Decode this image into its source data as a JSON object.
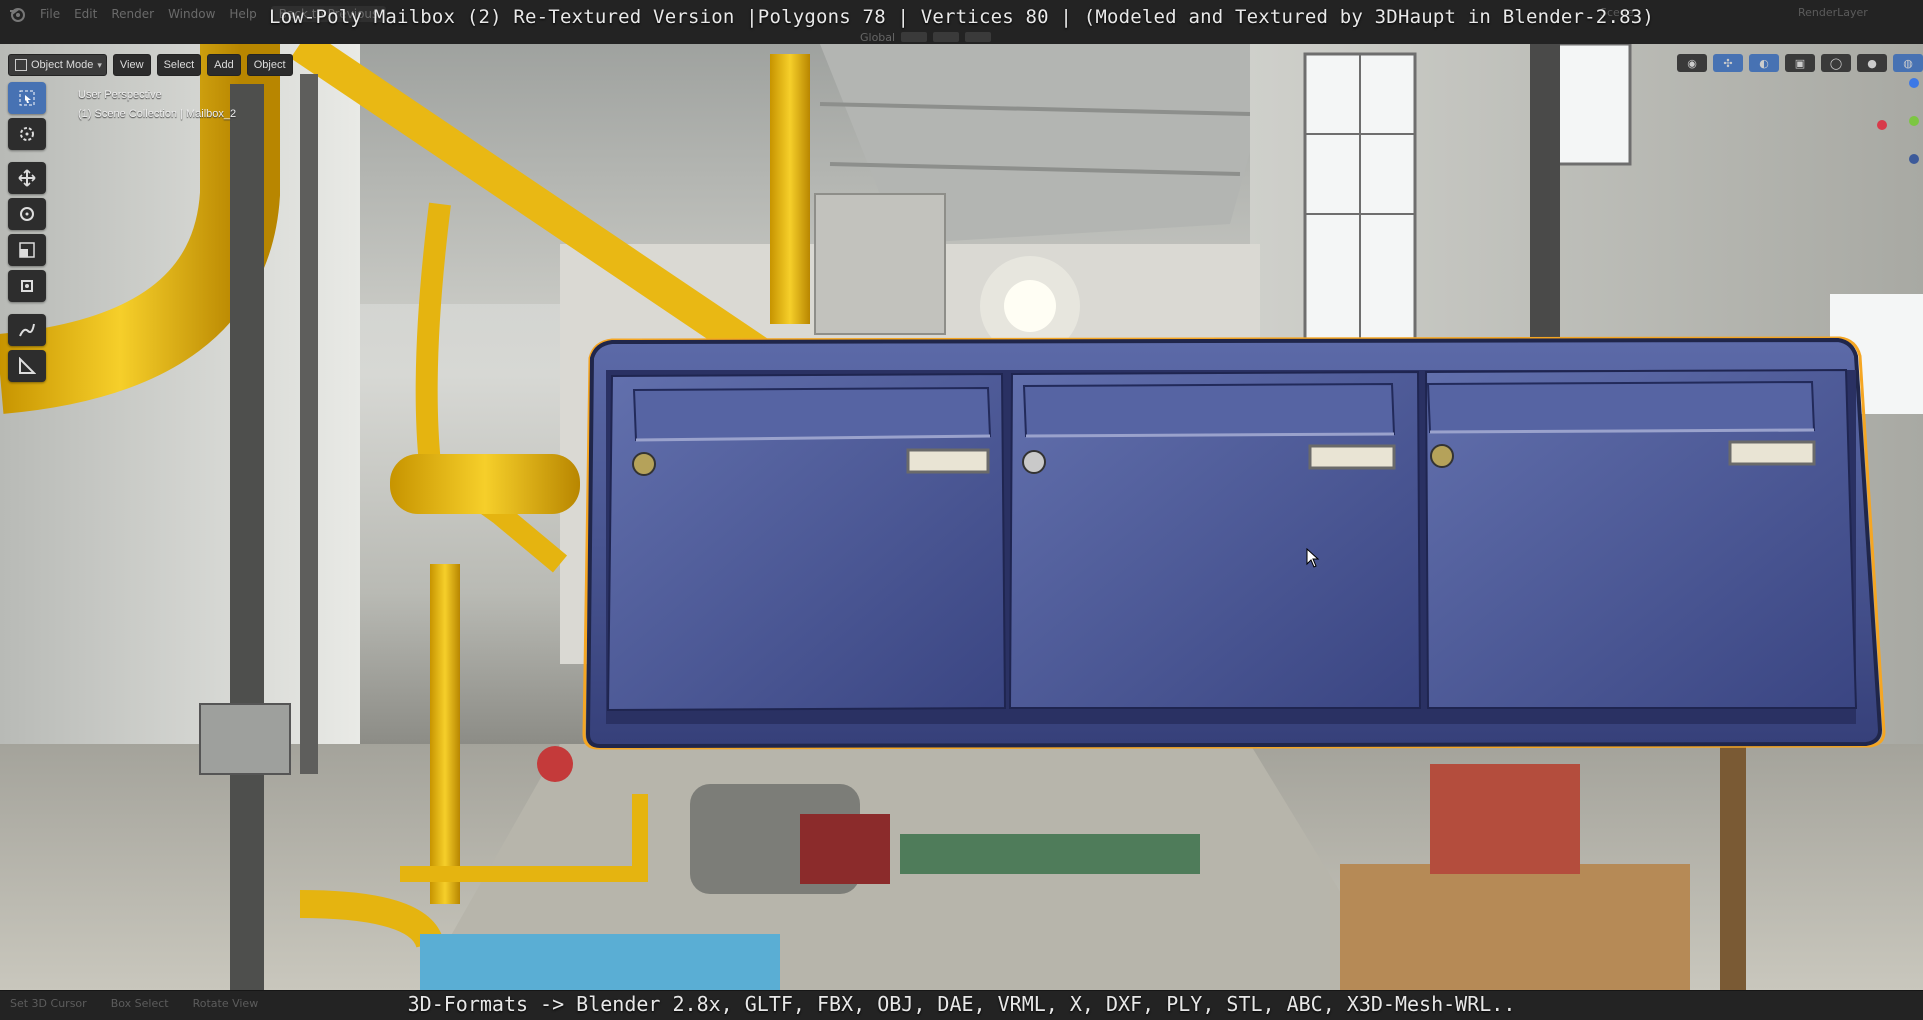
{
  "title_banner": "Low-Poly Mailbox (2) Re-Textured Version |Polygons 78 | Vertices 80 | (Modeled and Textured by 3DHaupt in Blender-2.83)",
  "top_menu": [
    "File",
    "Edit",
    "Render",
    "Window",
    "Help"
  ],
  "workspace_tab": "Back to Previous",
  "scene_label": "Scene",
  "render_layer_label": "RenderLayer",
  "orientation": "Global",
  "viewport_header": {
    "mode": "Object Mode",
    "menus": [
      "View",
      "Select",
      "Add",
      "Object"
    ]
  },
  "overlay": {
    "perspective": "User Perspective",
    "collection": "(1) Scene Collection | Mailbox_2"
  },
  "toolbar_icons": [
    "select-box-icon",
    "cursor-icon",
    "move-icon",
    "rotate-icon",
    "scale-icon",
    "transform-icon",
    "annotate-icon",
    "measure-icon"
  ],
  "status_bar": {
    "left_items": [
      "Set 3D Cursor",
      "Box Select",
      "Rotate View"
    ]
  },
  "bottom_banner": "3D-Formats -> Blender 2.8x, GLTF, FBX, OBJ, DAE, VRML, X, DXF, PLY, STL, ABC, X3D-Mesh-WRL..",
  "colors": {
    "accent": "#4772b3",
    "selection_outline": "#f5a623",
    "mailbox_body": "#3e4b86",
    "pipe_yellow": "#f2c21b"
  }
}
